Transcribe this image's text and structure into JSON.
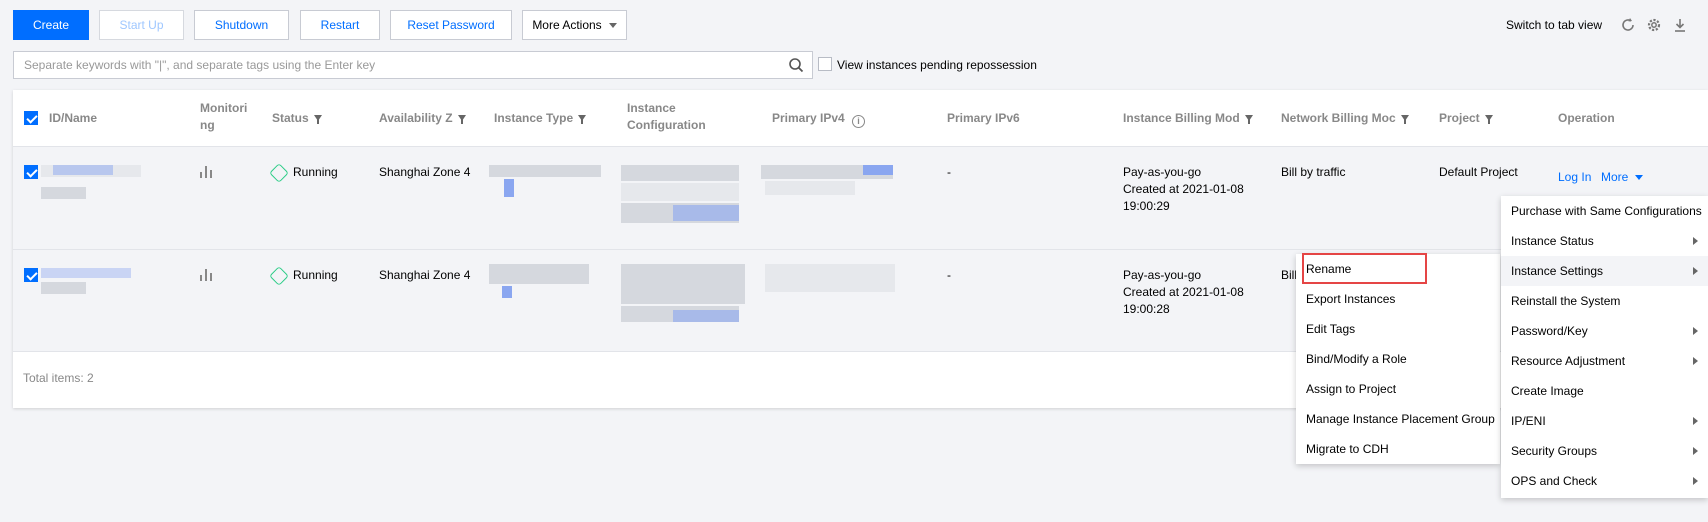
{
  "toolbar": {
    "create": "Create",
    "start_up": "Start Up",
    "shutdown": "Shutdown",
    "restart": "Restart",
    "reset_password": "Reset Password",
    "more_actions": "More Actions",
    "switch_view": "Switch to tab view"
  },
  "search": {
    "placeholder": "Separate keywords with \"|\", and separate tags using the Enter key",
    "pending_label": "View instances pending repossession"
  },
  "table": {
    "headers": {
      "id_name": "ID/Name",
      "monitoring": [
        "Monitori",
        "ng"
      ],
      "status": "Status",
      "availability_zone": "Availability Z",
      "instance_type": "Instance Type",
      "instance_config": [
        "Instance",
        "Configuration"
      ],
      "primary_ipv4": "Primary IPv4",
      "primary_ipv6": "Primary IPv6",
      "billing_mode": "Instance Billing Mod",
      "network_billing": "Network Billing Moc",
      "project": "Project",
      "operation": "Operation"
    },
    "rows": [
      {
        "status": "Running",
        "zone": "Shanghai Zone 4",
        "ipv6": "-",
        "billing": [
          "Pay-as-you-go",
          "Created at 2021-01-08",
          "19:00:29"
        ],
        "network": "Bill by traffic",
        "project": "Default Project",
        "login": "Log In",
        "more": "More"
      },
      {
        "status": "Running",
        "zone": "Shanghai Zone 4",
        "ipv6": "-",
        "billing": [
          "Pay-as-you-go",
          "Created at 2021-01-08",
          "19:00:28"
        ],
        "network": "Bill"
      }
    ],
    "total": "Total items: 2"
  },
  "main_menu": [
    "Purchase with Same Configurations",
    "Instance Status",
    "Instance Settings",
    "Reinstall the System",
    "Password/Key",
    "Resource Adjustment",
    "Create Image",
    "IP/ENI",
    "Security Groups",
    "OPS and Check"
  ],
  "sub_menu": [
    "Rename",
    "Export Instances",
    "Edit Tags",
    "Bind/Modify a Role",
    "Assign to Project",
    "Manage Instance Placement Group",
    "Migrate to CDH"
  ],
  "colors": {
    "accent": "#006eff",
    "running": "#29cc85",
    "highlight": "#e54545"
  }
}
